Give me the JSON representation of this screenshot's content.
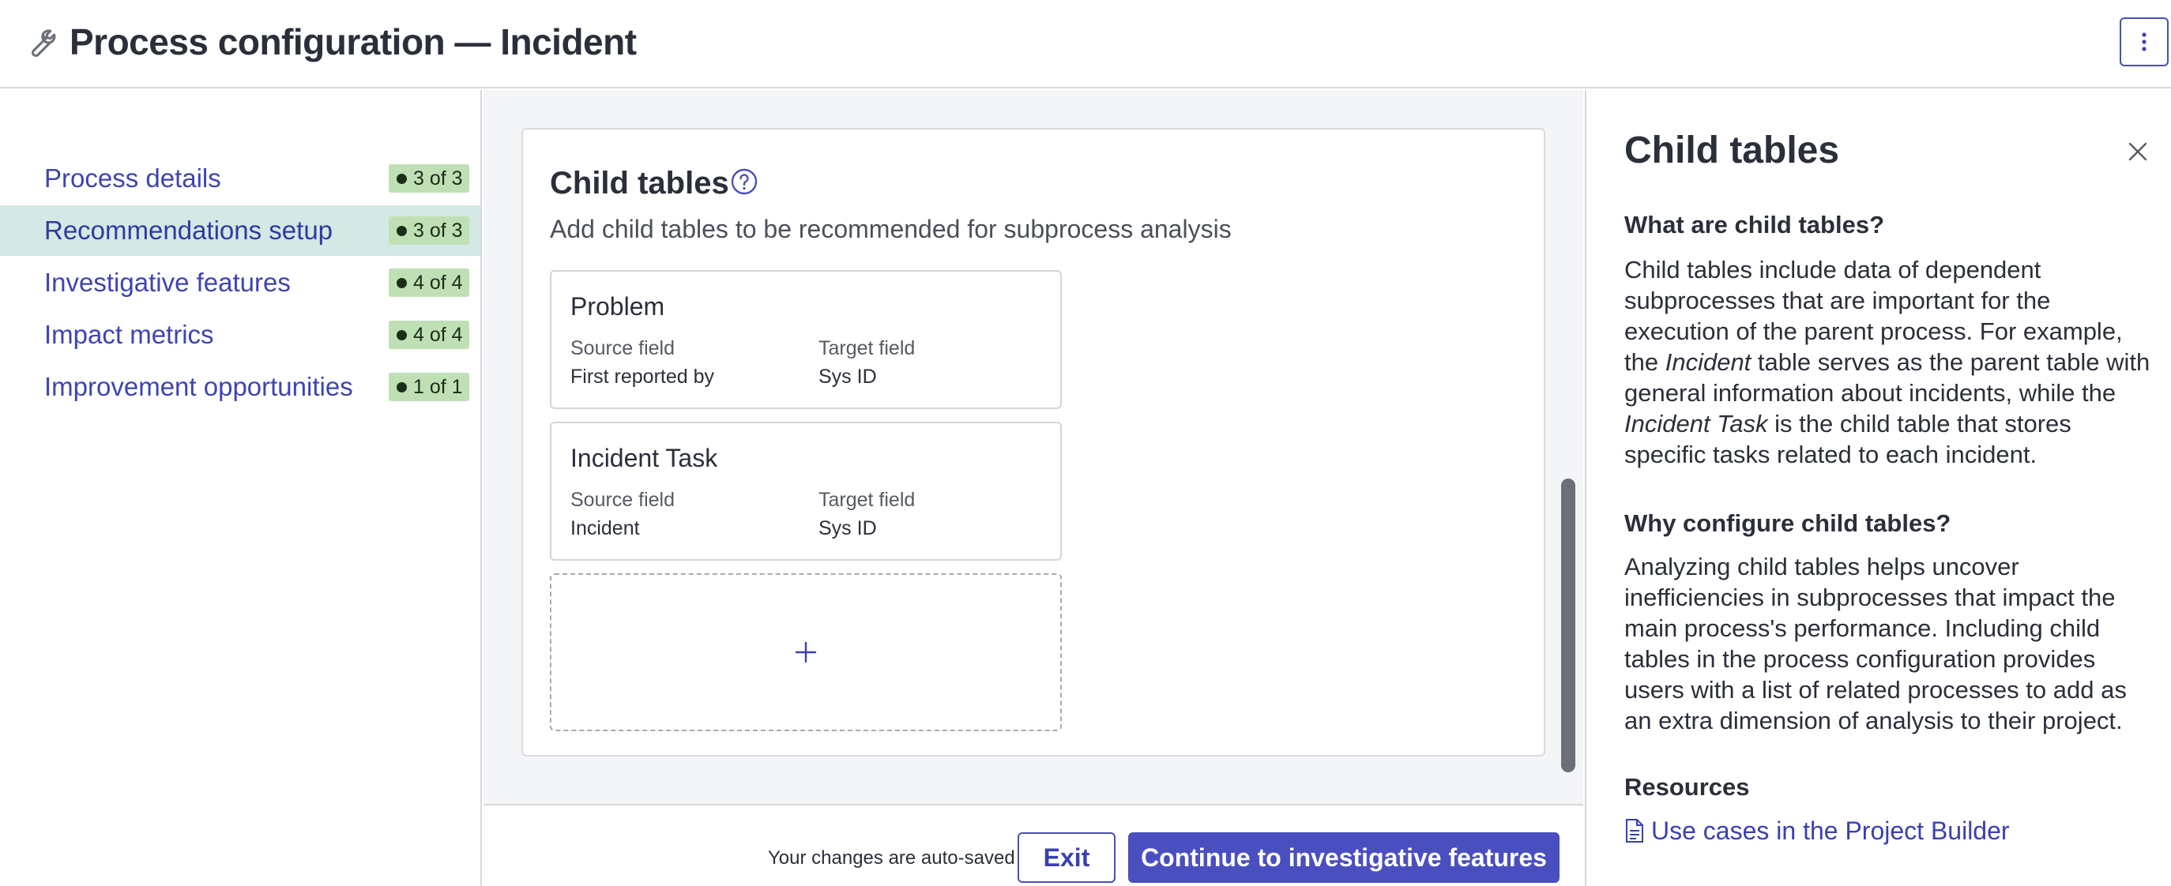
{
  "header": {
    "title": "Process configuration — Incident",
    "wrench_icon": "wrench-icon",
    "more_icon": "kebab-icon"
  },
  "nav": {
    "items": [
      {
        "label": "Process details",
        "badge": "3 of 3",
        "active": false
      },
      {
        "label": "Recommendations setup",
        "badge": "3 of 3",
        "active": true
      },
      {
        "label": "Investigative features",
        "badge": "4 of 4",
        "active": false
      },
      {
        "label": "Impact metrics",
        "badge": "4 of 4",
        "active": false
      },
      {
        "label": "Improvement opportunities",
        "badge": "1 of 1",
        "active": false
      }
    ]
  },
  "main": {
    "title": "Child tables",
    "subtitle": "Add child tables to be recommended for subprocess analysis",
    "source_label": "Source field",
    "target_label": "Target field",
    "children": [
      {
        "name": "Problem",
        "source": "First reported by",
        "target": "Sys ID"
      },
      {
        "name": "Incident Task",
        "source": "Incident",
        "target": "Sys ID"
      }
    ]
  },
  "footer": {
    "autosave": "Your changes are auto-saved",
    "exit_label": "Exit",
    "continue_label": "Continue to investigative features"
  },
  "panel": {
    "title": "Child tables",
    "what_heading": "What are child tables?",
    "what_text": {
      "part1": "Child tables include data of dependent subprocesses that are important for the execution of the parent process. For example, the ",
      "em1": "Incident",
      "part2": " table serves as the parent table with general information about incidents, while the ",
      "em2": "Incident Task",
      "part3": " is the child table that stores specific tasks related to each incident."
    },
    "why_heading": "Why configure child tables?",
    "why_text": "Analyzing child tables helps uncover inefficiencies in subprocesses that impact the main process's performance. Including child tables in the process configuration provides users with a list of related processes to add as an extra dimension of analysis to their project.",
    "resources_heading": "Resources",
    "resource_link": "Use cases in the Project Builder"
  },
  "colors": {
    "accent": "#4a4fc0",
    "nav_active_bg": "#d4e8e6",
    "badge_bg": "#bfe0b5"
  }
}
